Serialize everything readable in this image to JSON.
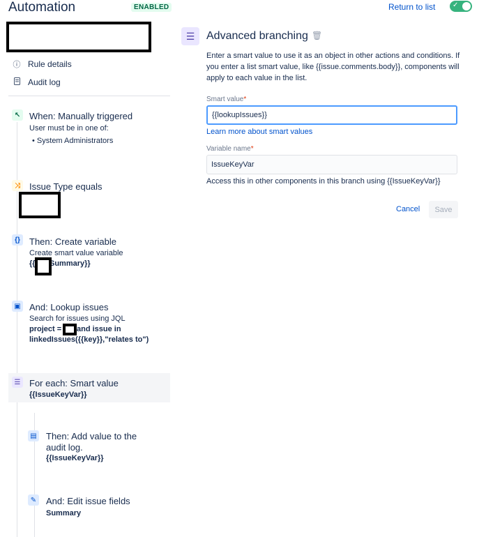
{
  "header": {
    "title": "Automation",
    "status_badge": "ENABLED",
    "return_link": "Return to list"
  },
  "nav": {
    "rule_details": "Rule details",
    "audit_log": "Audit log"
  },
  "steps": {
    "trigger": {
      "title": "When: Manually triggered",
      "sub": "User must be in one of:",
      "bullet": "System Administrators"
    },
    "condition": {
      "title": "Issue Type equals"
    },
    "create_variable": {
      "title": "Then: Create variable",
      "sub": "Create smart value variable",
      "value_prefix": "{{",
      "value_suffix": "Summary}}"
    },
    "lookup": {
      "title": "And: Lookup issues",
      "sub": "Search for issues using JQL",
      "jql_prefix": "project =",
      "jql_suffix": "and issue in",
      "jql_line2": "linkedIssues({{key}},\"relates to\")"
    },
    "branch": {
      "title": "For each: Smart value",
      "value": "{{IssueKeyVar}}"
    },
    "audit": {
      "title_line1": "Then: Add value to the",
      "title_line2": "audit log.",
      "value": "{{IssueKeyVar}}"
    },
    "edit": {
      "title": "And: Edit issue fields",
      "value": "Summary"
    }
  },
  "panel": {
    "title": "Advanced branching",
    "description": "Enter a smart value to use it as an object in other actions and conditions. If you enter a list smart value, like {{issue.comments.body}}, components will apply to each value in the list.",
    "smart_value_label": "Smart value",
    "smart_value": "{{lookupIssues}}",
    "learn_more": "Learn more about smart values",
    "variable_name_label": "Variable name",
    "variable_name": "IssueKeyVar",
    "access_hint": "Access this in other components in this branch using {{IssueKeyVar}}",
    "cancel": "Cancel",
    "save": "Save"
  },
  "colors": {
    "accent": "#0052cc",
    "toggle_on": "#36b37e",
    "focus_border": "#4c9aff"
  }
}
